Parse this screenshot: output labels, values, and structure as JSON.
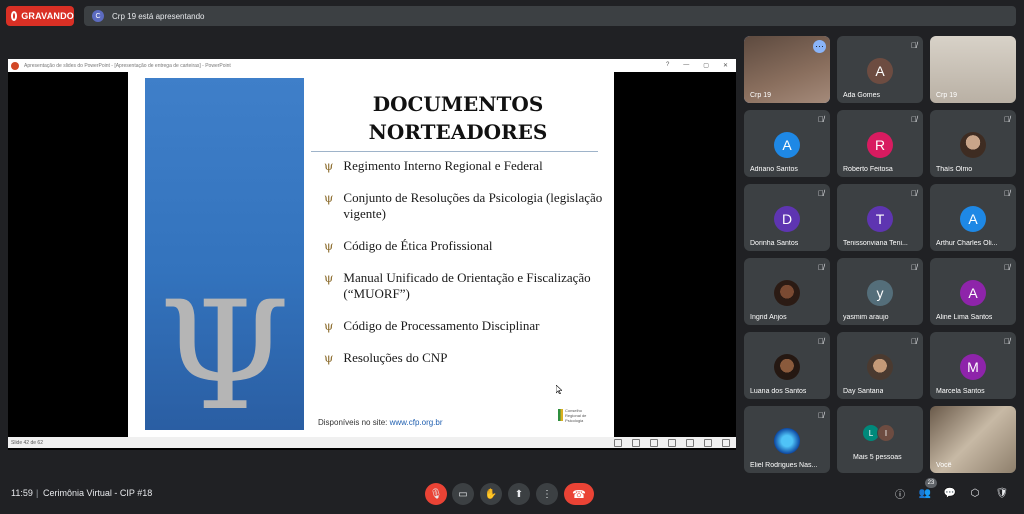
{
  "recording": {
    "label": "GRAVANDO"
  },
  "presenting": {
    "avatar_letter": "C",
    "text": "Crp 19 está apresentando"
  },
  "ppt_window": {
    "title": "Apresentação de slides do PowerPoint - [Apresentação de entrega de carteiras] - PowerPoint",
    "status": "Slide 42 de 62"
  },
  "slide": {
    "title_line1": "DOCUMENTOS",
    "title_line2": "NORTEADORES",
    "bullet_symbol": "ψ",
    "bullets": [
      "Regimento Interno Regional e Federal",
      "Conjunto de Resoluções da Psicologia (legislação vigente)",
      "Código de Ética Profissional",
      "Manual Unificado de Orientação e Fiscalização (“MUORF”)",
      "Código de Processamento Disciplinar",
      "Resoluções do CNP"
    ],
    "footer_label": "Disponíveis no site:",
    "footer_link": "www.cfp.org.br",
    "logo_text": "Conselho Regional de Psicologia"
  },
  "participants": [
    {
      "name": "Crp 19",
      "kind": "video",
      "speaking": true
    },
    {
      "name": "Ada Gomes",
      "letter": "A",
      "color": "#6d4c41",
      "muted": true
    },
    {
      "name": "Crp 19",
      "kind": "video"
    },
    {
      "name": "Adriano Santos",
      "letter": "A",
      "color": "#1e88e5",
      "muted": true
    },
    {
      "name": "Roberto Feitosa",
      "letter": "R",
      "color": "#d81b60",
      "muted": true
    },
    {
      "name": "Thaís Olmo",
      "kind": "photo",
      "muted": true
    },
    {
      "name": "Dorinha Santos",
      "letter": "D",
      "color": "#5e35b1",
      "muted": true
    },
    {
      "name": "Tenissonviana Teni...",
      "letter": "T",
      "color": "#5e35b1",
      "muted": true
    },
    {
      "name": "Arthur Charles Oli...",
      "letter": "A",
      "color": "#1e88e5",
      "muted": true
    },
    {
      "name": "Ingrid Anjos",
      "kind": "photo",
      "muted": true
    },
    {
      "name": "yasmim araujo",
      "letter": "y",
      "color": "#546e7a",
      "muted": true
    },
    {
      "name": "Aline Lima Santos",
      "letter": "A",
      "color": "#8e24aa",
      "muted": true
    },
    {
      "name": "Luana dos Santos",
      "kind": "photo",
      "muted": true
    },
    {
      "name": "Day Santana",
      "kind": "photo",
      "muted": true
    },
    {
      "name": "Marcela Santos",
      "letter": "M",
      "color": "#8e24aa",
      "muted": true
    },
    {
      "name": "Eliel Rodrigues Nas...",
      "kind": "photo",
      "muted": true
    },
    {
      "name": "Mais 5 pessoas",
      "kind": "more"
    },
    {
      "name": "Você",
      "kind": "video"
    }
  ],
  "more_avatars": [
    "L",
    "I"
  ],
  "bottom": {
    "time": "11:59",
    "separator": "|",
    "meeting_name": "Cerimônia Virtual - CIP #18",
    "participant_count": "23"
  },
  "controls": {
    "mic": "🎙",
    "camera": "▭",
    "hand": "✋",
    "present": "⬆",
    "more": "⋮",
    "hangup": "☎",
    "info": "ⓘ",
    "people": "👥",
    "chat": "💬",
    "activities": "⬡",
    "safety": "🛡"
  },
  "colors": {
    "accent": "#8ab4f8",
    "danger": "#ea4335",
    "tile": "#3c4043",
    "bg": "#202124"
  }
}
